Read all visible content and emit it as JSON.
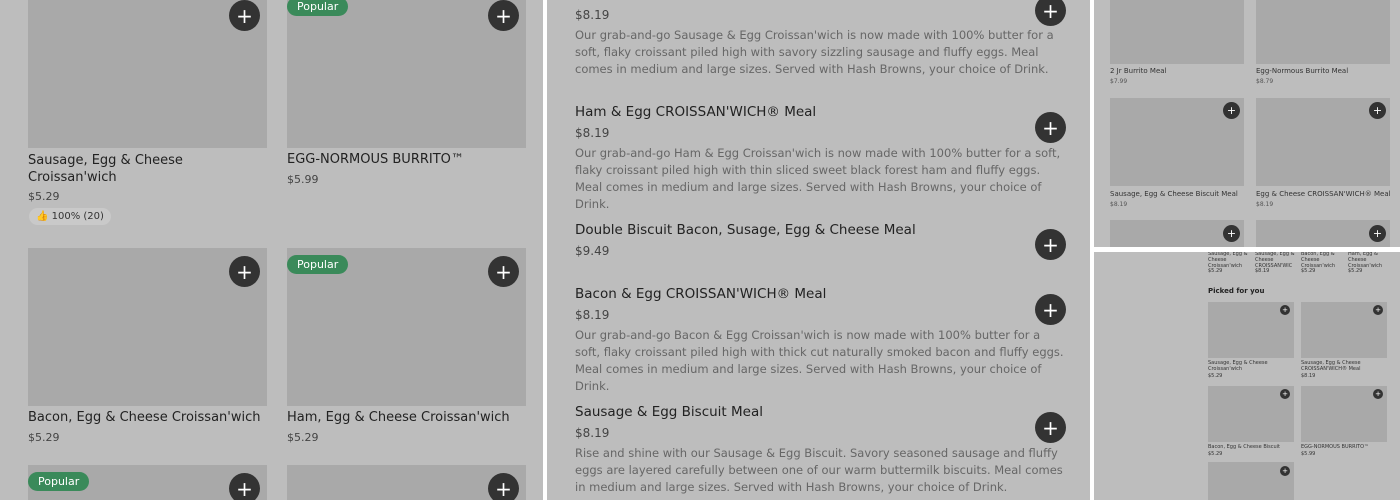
{
  "colors": {
    "panel_bg": "#bdbdbd",
    "image_placeholder": "#a9a9a9",
    "accent_popular": "#3a8a5a",
    "add_button": "#333333"
  },
  "icons": {
    "add": "plus-icon",
    "rating": "thumbs-up-icon"
  },
  "grid_panel": {
    "add_symbol": "+",
    "items": [
      {
        "name": "",
        "price": "",
        "badge": ""
      },
      {
        "name": "",
        "price": "",
        "badge": "Popular"
      },
      {
        "name": "Sausage, Egg & Cheese Croissan'wich",
        "price": "$5.29",
        "rating": "100% (20)"
      },
      {
        "name": "EGG-NORMOUS BURRITO™",
        "price": "$5.99"
      },
      {
        "name": "Bacon, Egg & Cheese Croissan'wich",
        "price": "$5.29"
      },
      {
        "name": "Ham, Egg & Cheese Croissan'wich",
        "price": "$5.29",
        "badge": "Popular"
      },
      {
        "badge": "Popular"
      }
    ]
  },
  "menu_list": {
    "items": [
      {
        "name": "",
        "price": "$8.19",
        "description": "Our grab-and-go Sausage & Egg Croissan'wich is now made with 100% butter for a soft, flaky croissant piled high with savory sizzling sausage and fluffy eggs. Meal comes in medium and large sizes. Served with Hash Browns, your choice of Drink."
      },
      {
        "name": "Ham & Egg CROISSAN'WICH® Meal",
        "price": "$8.19",
        "description": "Our grab-and-go Ham & Egg Croissan'wich is now made with 100% butter for a soft, flaky croissant piled high with thin sliced sweet black forest ham and fluffy eggs. Meal comes in medium and large sizes. Served with Hash Browns, your choice of Drink."
      },
      {
        "name": "Double Biscuit Bacon, Susage, Egg & Cheese Meal",
        "price": "$9.49",
        "description": ""
      },
      {
        "name": "Bacon & Egg CROISSAN'WICH® Meal",
        "price": "$8.19",
        "description": "Our grab-and-go Bacon & Egg Croissan'wich is now made with 100% butter for a soft, flaky croissant piled high with thick cut naturally smoked bacon and fluffy eggs. Meal comes in medium and large sizes. Served with Hash Browns, your choice of Drink."
      },
      {
        "name": "Sausage & Egg Biscuit Meal",
        "price": "$8.19",
        "description": "Rise and shine with our Sausage & Egg Biscuit. Savory seasoned sausage and fluffy eggs are layered carefully between one of our warm buttermilk biscuits. Meal comes in medium and large sizes. Served with Hash Browns, your choice of Drink."
      }
    ]
  },
  "small_grid": {
    "items": [
      {
        "name": "2 Jr Burrito Meal",
        "price": "$7.99"
      },
      {
        "name": "Egg-Normous Burrito Meal",
        "price": "$8.79"
      },
      {
        "name": "Sausage, Egg & Cheese Biscuit Meal",
        "price": "$8.19"
      },
      {
        "name": "Egg & Cheese CROISSAN'WICH® Meal",
        "price": "$8.19"
      }
    ]
  },
  "mini_panel": {
    "top_row": [
      {
        "name": "Sausage, Egg & Cheese Croissan'wich",
        "price": "$5.29"
      },
      {
        "name": "Sausage, Egg & Cheese CROISSAN'WIC",
        "price": "$8.19"
      },
      {
        "name": "Bacon, Egg & Cheese Croissan'wich",
        "price": "$5.29"
      },
      {
        "name": "Ham, Egg & Cheese Croissan'wich",
        "price": "$5.29"
      }
    ],
    "section_title": "Picked for you",
    "items": [
      {
        "name": "Sausage, Egg & Cheese Croissan'wich",
        "price": "$5.29"
      },
      {
        "name": "Sausage, Egg & Cheese CROISSAN'WICH® Meal",
        "price": "$8.19"
      },
      {
        "name": "Bacon, Egg & Cheese Biscuit",
        "price": "$5.29"
      },
      {
        "name": "EGG-NORMOUS BURRITO™",
        "price": "$5.99"
      }
    ]
  }
}
